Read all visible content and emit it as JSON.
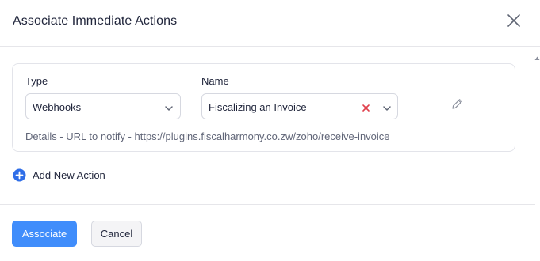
{
  "dialog": {
    "title": "Associate Immediate Actions",
    "close_icon": "close-icon"
  },
  "action": {
    "type_label": "Type",
    "type_value": "Webhooks",
    "name_label": "Name",
    "name_value": "Fiscalizing an Invoice",
    "details": "Details - URL to notify - https://plugins.fiscalharmony.co.zw/zoho/receive-invoice",
    "icons": {
      "clear": "clear-x-icon",
      "edit": "pencil-icon",
      "dropdown": "chevron-down-icon"
    }
  },
  "add_action": {
    "label": "Add New Action",
    "icon": "plus-circle-icon"
  },
  "footer": {
    "primary_label": "Associate",
    "secondary_label": "Cancel"
  },
  "colors": {
    "primary": "#408dfb",
    "clear_x": "#e0404c",
    "text": "#21263c",
    "muted": "#616678"
  }
}
